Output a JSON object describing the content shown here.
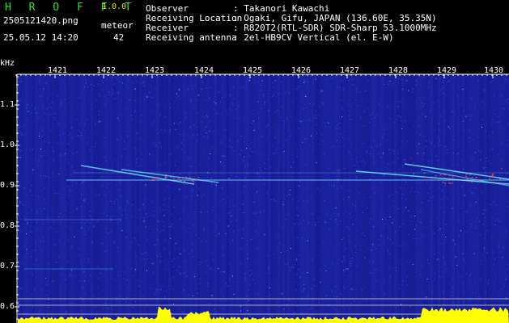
{
  "header": {
    "app_title": "H R O F F T",
    "app_version": "1.0.0",
    "file_name": "2505121420.png",
    "meteor_label": "meteor",
    "date_time": "25.05.12 14:20",
    "meteor_count": "42"
  },
  "info": [
    {
      "label": "Observer",
      "value": ": Takanori Kawachi"
    },
    {
      "label": "Receiving Location",
      "value": ": Ogaki, Gifu, JAPAN (136.60E, 35.35N)"
    },
    {
      "label": "Receiver",
      "value": ": R820T2(RTL-SDR) SDR-Sharp 53.1000MHz"
    },
    {
      "label": "Receiving antenna",
      "value": ": 2el-HB9CV Vertical (el. E-W)"
    }
  ],
  "spectrogram": {
    "x_unit_label": "kHz",
    "x_ticks": [
      "1421",
      "1422",
      "1423",
      "1424",
      "1425",
      "1426",
      "1427",
      "1428",
      "1429",
      "1430"
    ],
    "y_ticks": [
      "1.1",
      "1.0",
      "0.9",
      "0.8",
      "0.7",
      "0.6"
    ],
    "colors": {
      "background": "#16188e",
      "noise": "#3a5cff",
      "echo": "#6be8ff",
      "hot": "#ff5050",
      "level_bar": "#ffff00",
      "grid": "#c8c8c8"
    }
  }
}
